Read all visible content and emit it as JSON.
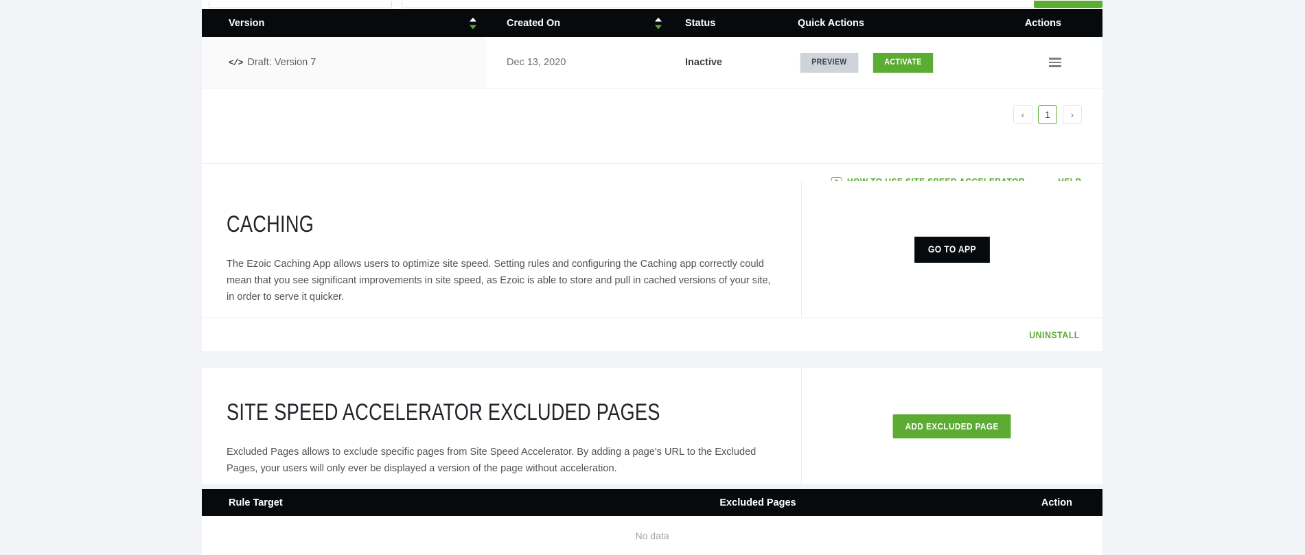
{
  "colors": {
    "green": "#5cab33",
    "black": "#060a0d",
    "page_bg": "#f2f3f7",
    "preview_btn": "#ced4da"
  },
  "versions_table": {
    "columns": [
      {
        "label": "Version",
        "sortable": true
      },
      {
        "label": "Created On",
        "sortable": true
      },
      {
        "label": "Status",
        "sortable": false
      },
      {
        "label": "Quick Actions",
        "sortable": false
      },
      {
        "label": "Actions",
        "sortable": false
      }
    ],
    "rows": [
      {
        "version": "Draft: Version 7",
        "version_icon": "code-icon",
        "created_on": "Dec 13, 2020",
        "status": "Inactive",
        "preview_label": "PREVIEW",
        "activate_label": "ACTIVATE",
        "row_menu_icon": "hamburger-menu-icon"
      }
    ]
  },
  "pagination": {
    "prev": "‹",
    "next": "›",
    "current_page": "1"
  },
  "help_bar": {
    "video_link": "HOW TO USE SITE SPEED ACCELERATOR",
    "help_link": "HELP"
  },
  "caching": {
    "title": "CACHING",
    "body": "The Ezoic Caching App allows users to optimize site speed. Setting rules and configuring the Caching app correctly could mean that you see significant improvements in site speed, as Ezoic is able to store and pull in cached versions of your site, in order to serve it quicker.",
    "go_to_app_label": "GO TO APP",
    "uninstall_label": "UNINSTALL"
  },
  "excluded_pages": {
    "title": "SITE SPEED ACCELERATOR EXCLUDED PAGES",
    "body": "Excluded Pages allows to exclude specific pages from Site Speed Accelerator. By adding a page's URL to the Excluded Pages, your users will only ever be displayed a version of the page without acceleration.",
    "add_button_label": "ADD EXCLUDED PAGE",
    "table": {
      "columns": [
        "Rule Target",
        "Excluded Pages",
        "Action"
      ],
      "empty_message": "No data"
    }
  }
}
